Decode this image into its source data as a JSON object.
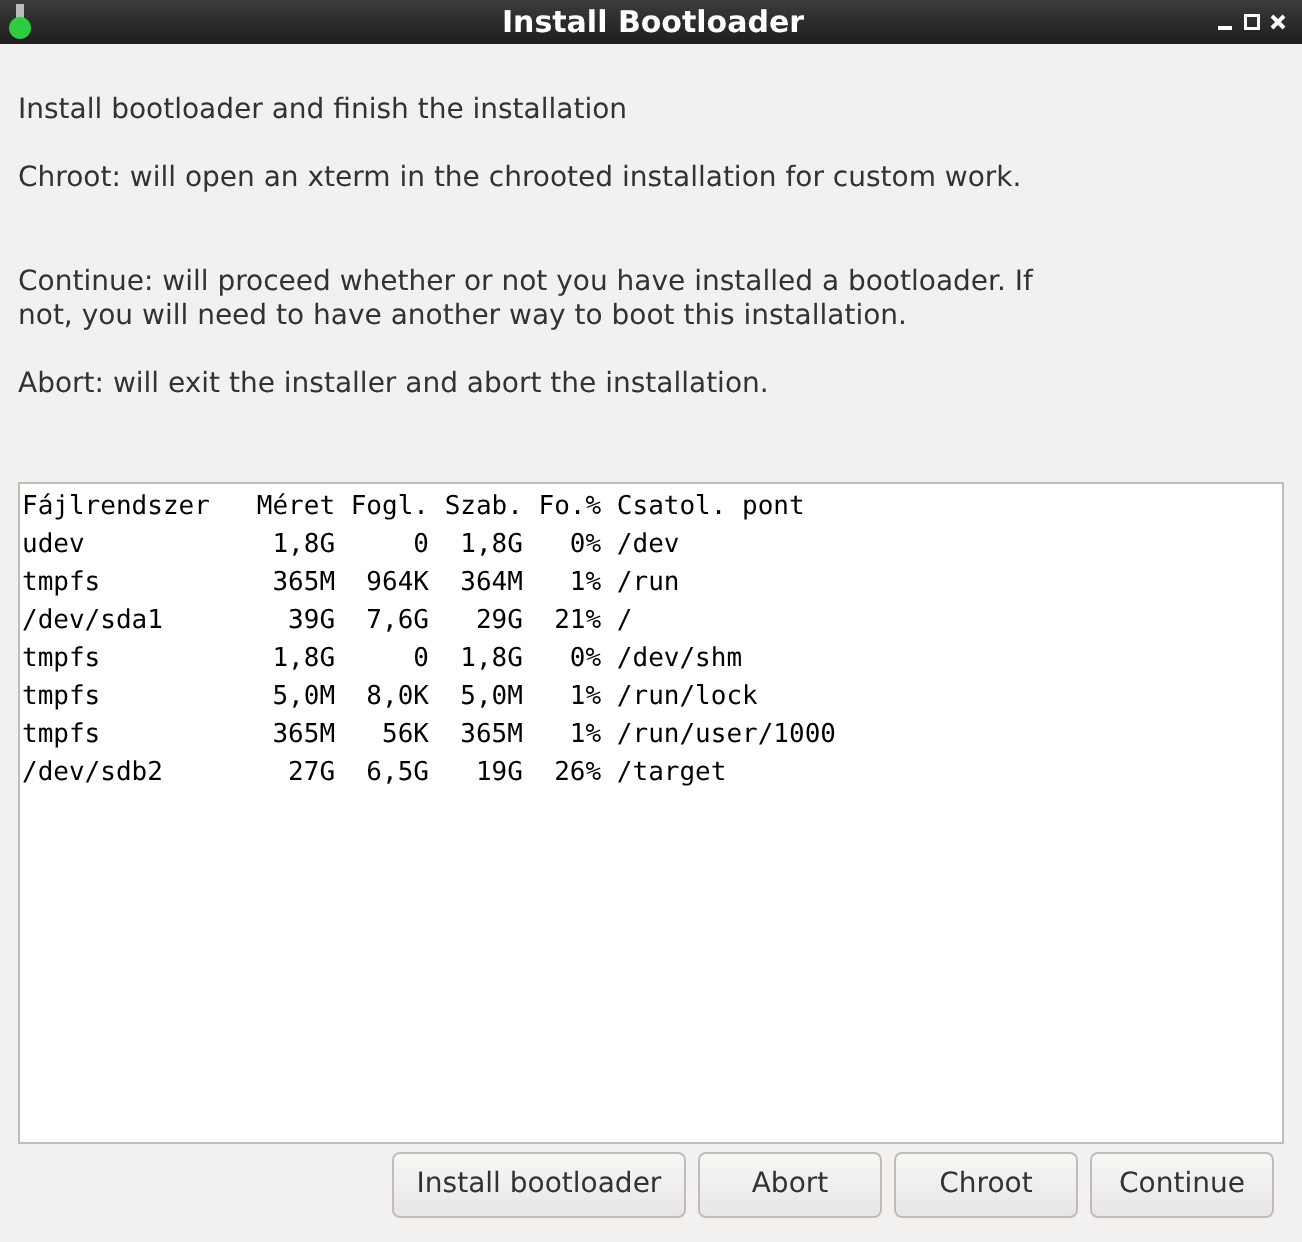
{
  "window": {
    "title": "Install Bootloader"
  },
  "paragraphs": [
    "Install bootloader and finish the installation",
    "Chroot: will open an xterm in the chrooted installation for custom work.",
    "Continue: will proceed whether or not you have installed a bootloader. If not, you will need to have another way to boot this installation.",
    "Abort: will exit the installer and abort the installation."
  ],
  "output_lines": [
    "Fájlrendszer   Méret Fogl. Szab. Fo.% Csatol. pont",
    "udev            1,8G     0  1,8G   0% /dev",
    "tmpfs           365M  964K  364M   1% /run",
    "/dev/sda1        39G  7,6G   29G  21% /",
    "tmpfs           1,8G     0  1,8G   0% /dev/shm",
    "tmpfs           5,0M  8,0K  5,0M   1% /run/lock",
    "tmpfs           365M   56K  365M   1% /run/user/1000",
    "/dev/sdb2        27G  6,5G   19G  26% /target"
  ],
  "buttons": [
    "Install bootloader",
    "Abort",
    "Chroot",
    "Continue"
  ]
}
